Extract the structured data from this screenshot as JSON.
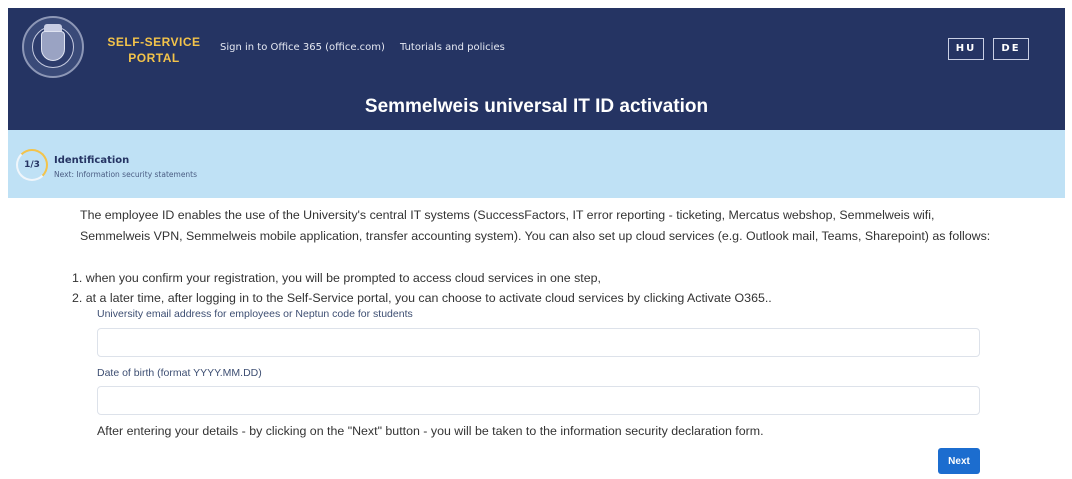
{
  "header": {
    "portal_title_line1": "SELF-SERVICE",
    "portal_title_line2": "PORTAL",
    "nav_links": [
      "Sign in to Office 365 (office.com)",
      "Tutorials and policies"
    ],
    "languages": [
      "HU",
      "DE"
    ],
    "page_title": "Semmelweis universal IT ID activation"
  },
  "stepper": {
    "indicator": "1/3",
    "name": "Identification",
    "next_text": "Next: Information security statements"
  },
  "content": {
    "intro": "The employee ID enables the use of the University's central IT systems (SuccessFactors, IT error reporting - ticketing, Mercatus webshop, Semmelweis wifi, Semmelweis VPN, Semmelweis mobile application, transfer accounting system). You can also set up cloud services (e.g. Outlook mail, Teams, Sharepoint) as follows:",
    "steps": [
      "1. when you confirm your registration, you will be prompted to access cloud services in one step,",
      "2. at a later time, after logging in to the Self-Service portal, you can choose to activate cloud services by clicking Activate O365.."
    ],
    "form": {
      "email_label": "University email address for employees or Neptun code for students",
      "email_value": "",
      "dob_label": "Date of birth (format YYYY.MM.DD)",
      "dob_value": ""
    },
    "after_text": "After entering your details - by clicking on the \"Next\" button - you will be taken to the information security declaration form.",
    "next_button": "Next"
  },
  "colors": {
    "header_bg": "#253463",
    "accent_gold": "#f3c34a",
    "step_bg": "#bfe1f5",
    "button_blue": "#1c6dcf"
  },
  "icons": {
    "logo": "university-seal-icon",
    "step": "progress-ring-icon"
  }
}
